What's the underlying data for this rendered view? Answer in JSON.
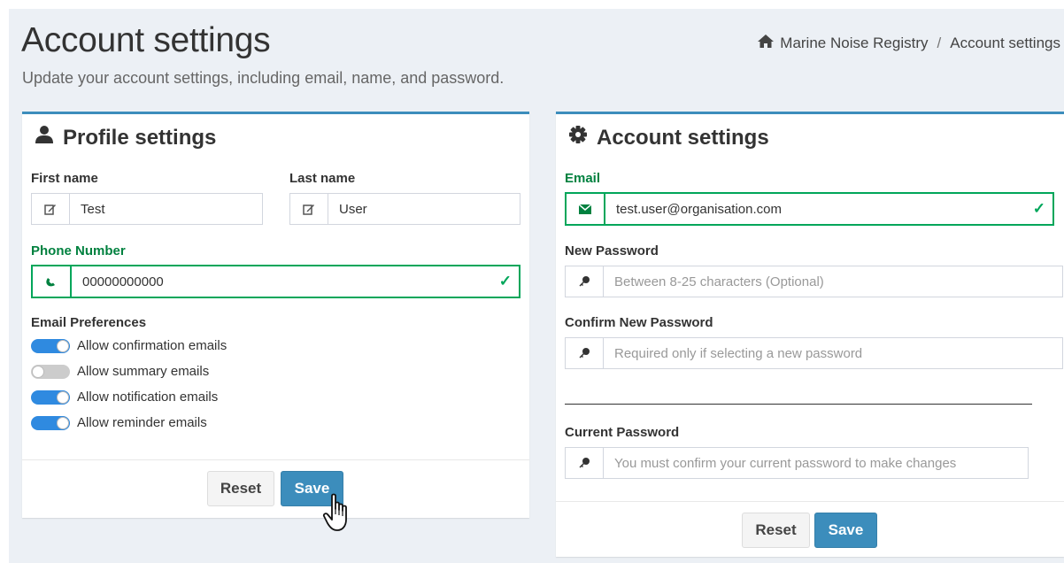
{
  "header": {
    "title": "Account settings",
    "subtitle": "Update your account settings, including email, name, and password.",
    "breadcrumb": {
      "home_label": "Marine Noise Registry",
      "separator": "/",
      "current": "Account settings"
    }
  },
  "profile": {
    "title": "Profile settings",
    "icon": "user-icon",
    "first_name_label": "First name",
    "first_name_value": "Test",
    "last_name_label": "Last name",
    "last_name_value": "User",
    "phone_label": "Phone Number",
    "phone_value": "00000000000",
    "preferences_label": "Email Preferences",
    "preferences": [
      {
        "label": "Allow confirmation emails",
        "enabled": true
      },
      {
        "label": "Allow summary emails",
        "enabled": false
      },
      {
        "label": "Allow notification emails",
        "enabled": true
      },
      {
        "label": "Allow reminder emails",
        "enabled": true
      }
    ],
    "reset_label": "Reset",
    "save_label": "Save"
  },
  "account": {
    "title": "Account settings",
    "icon": "gear-icon",
    "email_label": "Email",
    "email_value": "test.user@organisation.com",
    "new_password_label": "New Password",
    "new_password_placeholder": "Between 8-25 characters (Optional)",
    "confirm_password_label": "Confirm New Password",
    "confirm_password_placeholder": "Required only if selecting a new password",
    "current_password_label": "Current Password",
    "current_password_placeholder": "You must confirm your current password to make changes",
    "reset_label": "Reset",
    "save_label": "Save"
  },
  "colors": {
    "accent": "#3c8dbc",
    "success": "#00a65a",
    "toggle_on": "#2f8ae0",
    "toggle_off": "#cccccc"
  }
}
